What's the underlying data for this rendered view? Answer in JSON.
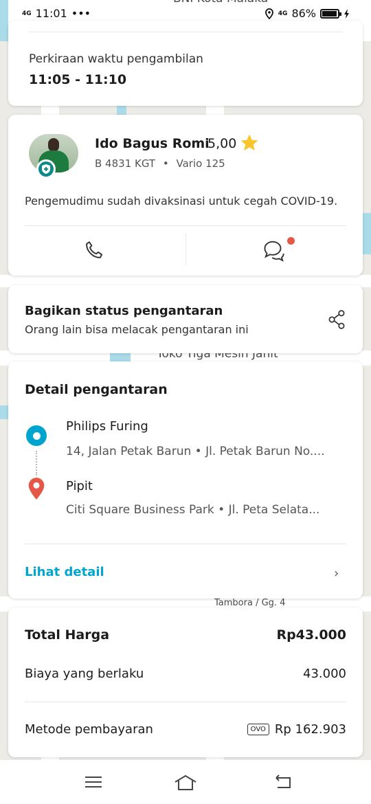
{
  "status_bar": {
    "network": "4G",
    "time": "11:01",
    "more": "•••",
    "network_right": "4G",
    "battery": "86%",
    "battery_level": 0.86
  },
  "map": {
    "labels": {
      "top": "BNI Kota Malaka",
      "middle": "Toko Tiga Mesin Jahit",
      "bottom": "Tambora / Gg. 4"
    }
  },
  "pickup": {
    "label": "Perkiraan waktu pengambilan",
    "time_window": "11:05 - 11:10"
  },
  "driver": {
    "name": "Ido Bagus Romi",
    "rating": "5,00",
    "plate": "B 4831 KGT",
    "vehicle": "Vario 125",
    "separator": "•",
    "vaccination_note": "Pengemudimu sudah divaksinasi untuk cegah COVID-19."
  },
  "share": {
    "title": "Bagikan status pengantaran",
    "subtitle": "Orang lain bisa melacak pengantaran ini"
  },
  "delivery": {
    "heading": "Detail pengantaran",
    "origin": {
      "name": "Philips Furing",
      "address": "14, Jalan Petak Barun  •  Jl. Petak Barun No...."
    },
    "destination": {
      "name": "Pipit",
      "address": "Citi Square Business Park  •  Jl. Peta Selata..."
    },
    "detail_link": "Lihat detail",
    "chevron": "›"
  },
  "price": {
    "total_label": "Total Harga",
    "total_value": "Rp43.000",
    "fee_label": "Biaya yang berlaku",
    "fee_value": "43.000",
    "payment_label": "Metode pembayaran",
    "payment_method": "OVO",
    "payment_balance": "Rp 162.903"
  },
  "colors": {
    "accent": "#00a5cf",
    "star": "#f8c52c",
    "notification": "#e55848",
    "shield": "#0b8a8a",
    "destination_pin": "#e55848"
  }
}
